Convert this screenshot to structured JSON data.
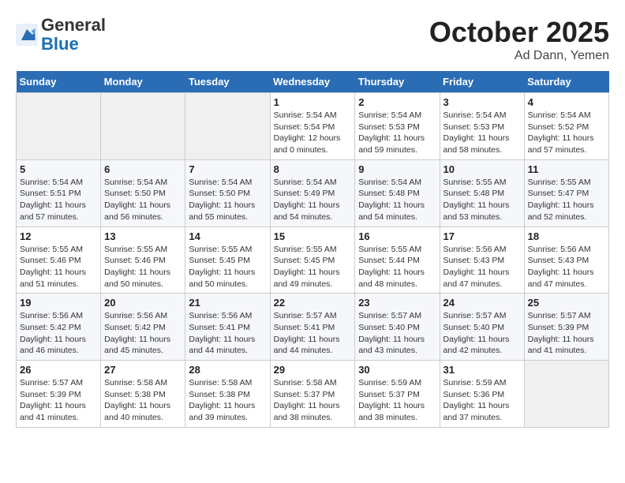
{
  "header": {
    "logo_general": "General",
    "logo_blue": "Blue",
    "month": "October 2025",
    "location": "Ad Dann, Yemen"
  },
  "weekdays": [
    "Sunday",
    "Monday",
    "Tuesday",
    "Wednesday",
    "Thursday",
    "Friday",
    "Saturday"
  ],
  "weeks": [
    [
      {
        "day": "",
        "info": ""
      },
      {
        "day": "",
        "info": ""
      },
      {
        "day": "",
        "info": ""
      },
      {
        "day": "1",
        "info": "Sunrise: 5:54 AM\nSunset: 5:54 PM\nDaylight: 12 hours\nand 0 minutes."
      },
      {
        "day": "2",
        "info": "Sunrise: 5:54 AM\nSunset: 5:53 PM\nDaylight: 11 hours\nand 59 minutes."
      },
      {
        "day": "3",
        "info": "Sunrise: 5:54 AM\nSunset: 5:53 PM\nDaylight: 11 hours\nand 58 minutes."
      },
      {
        "day": "4",
        "info": "Sunrise: 5:54 AM\nSunset: 5:52 PM\nDaylight: 11 hours\nand 57 minutes."
      }
    ],
    [
      {
        "day": "5",
        "info": "Sunrise: 5:54 AM\nSunset: 5:51 PM\nDaylight: 11 hours\nand 57 minutes."
      },
      {
        "day": "6",
        "info": "Sunrise: 5:54 AM\nSunset: 5:50 PM\nDaylight: 11 hours\nand 56 minutes."
      },
      {
        "day": "7",
        "info": "Sunrise: 5:54 AM\nSunset: 5:50 PM\nDaylight: 11 hours\nand 55 minutes."
      },
      {
        "day": "8",
        "info": "Sunrise: 5:54 AM\nSunset: 5:49 PM\nDaylight: 11 hours\nand 54 minutes."
      },
      {
        "day": "9",
        "info": "Sunrise: 5:54 AM\nSunset: 5:48 PM\nDaylight: 11 hours\nand 54 minutes."
      },
      {
        "day": "10",
        "info": "Sunrise: 5:55 AM\nSunset: 5:48 PM\nDaylight: 11 hours\nand 53 minutes."
      },
      {
        "day": "11",
        "info": "Sunrise: 5:55 AM\nSunset: 5:47 PM\nDaylight: 11 hours\nand 52 minutes."
      }
    ],
    [
      {
        "day": "12",
        "info": "Sunrise: 5:55 AM\nSunset: 5:46 PM\nDaylight: 11 hours\nand 51 minutes."
      },
      {
        "day": "13",
        "info": "Sunrise: 5:55 AM\nSunset: 5:46 PM\nDaylight: 11 hours\nand 50 minutes."
      },
      {
        "day": "14",
        "info": "Sunrise: 5:55 AM\nSunset: 5:45 PM\nDaylight: 11 hours\nand 50 minutes."
      },
      {
        "day": "15",
        "info": "Sunrise: 5:55 AM\nSunset: 5:45 PM\nDaylight: 11 hours\nand 49 minutes."
      },
      {
        "day": "16",
        "info": "Sunrise: 5:55 AM\nSunset: 5:44 PM\nDaylight: 11 hours\nand 48 minutes."
      },
      {
        "day": "17",
        "info": "Sunrise: 5:56 AM\nSunset: 5:43 PM\nDaylight: 11 hours\nand 47 minutes."
      },
      {
        "day": "18",
        "info": "Sunrise: 5:56 AM\nSunset: 5:43 PM\nDaylight: 11 hours\nand 47 minutes."
      }
    ],
    [
      {
        "day": "19",
        "info": "Sunrise: 5:56 AM\nSunset: 5:42 PM\nDaylight: 11 hours\nand 46 minutes."
      },
      {
        "day": "20",
        "info": "Sunrise: 5:56 AM\nSunset: 5:42 PM\nDaylight: 11 hours\nand 45 minutes."
      },
      {
        "day": "21",
        "info": "Sunrise: 5:56 AM\nSunset: 5:41 PM\nDaylight: 11 hours\nand 44 minutes."
      },
      {
        "day": "22",
        "info": "Sunrise: 5:57 AM\nSunset: 5:41 PM\nDaylight: 11 hours\nand 44 minutes."
      },
      {
        "day": "23",
        "info": "Sunrise: 5:57 AM\nSunset: 5:40 PM\nDaylight: 11 hours\nand 43 minutes."
      },
      {
        "day": "24",
        "info": "Sunrise: 5:57 AM\nSunset: 5:40 PM\nDaylight: 11 hours\nand 42 minutes."
      },
      {
        "day": "25",
        "info": "Sunrise: 5:57 AM\nSunset: 5:39 PM\nDaylight: 11 hours\nand 41 minutes."
      }
    ],
    [
      {
        "day": "26",
        "info": "Sunrise: 5:57 AM\nSunset: 5:39 PM\nDaylight: 11 hours\nand 41 minutes."
      },
      {
        "day": "27",
        "info": "Sunrise: 5:58 AM\nSunset: 5:38 PM\nDaylight: 11 hours\nand 40 minutes."
      },
      {
        "day": "28",
        "info": "Sunrise: 5:58 AM\nSunset: 5:38 PM\nDaylight: 11 hours\nand 39 minutes."
      },
      {
        "day": "29",
        "info": "Sunrise: 5:58 AM\nSunset: 5:37 PM\nDaylight: 11 hours\nand 38 minutes."
      },
      {
        "day": "30",
        "info": "Sunrise: 5:59 AM\nSunset: 5:37 PM\nDaylight: 11 hours\nand 38 minutes."
      },
      {
        "day": "31",
        "info": "Sunrise: 5:59 AM\nSunset: 5:36 PM\nDaylight: 11 hours\nand 37 minutes."
      },
      {
        "day": "",
        "info": ""
      }
    ]
  ]
}
